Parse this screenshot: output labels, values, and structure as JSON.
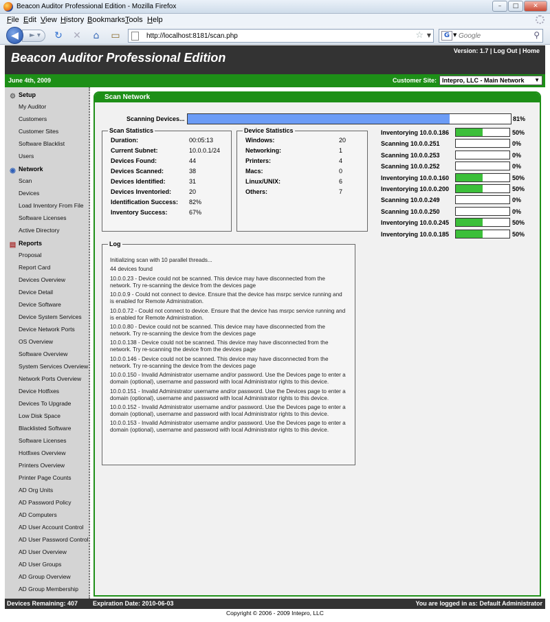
{
  "window": {
    "title": "Beacon Auditor Professional Edition - Mozilla Firefox",
    "controls": [
      "minimize",
      "maximize",
      "close"
    ]
  },
  "menubar": [
    "File",
    "Edit",
    "View",
    "History",
    "Bookmarks",
    "Tools",
    "Help"
  ],
  "navbar": {
    "url": "http://localhost:8181/scan.php",
    "search_placeholder": "Google",
    "search_engine_icon": "G"
  },
  "header": {
    "title": "Beacon Auditor Professional Edition",
    "version": "Version: 1.7",
    "logout": "Log Out",
    "home": "Home",
    "separator": "|"
  },
  "greenbar": {
    "date": "June 4th, 2009",
    "site_label": "Customer Site:",
    "site_value": "Intepro, LLC - Main Network"
  },
  "sidebar": {
    "setup": {
      "label": "Setup",
      "items": [
        "My Auditor",
        "Customers",
        "Customer Sites",
        "Software Blacklist",
        "Users"
      ]
    },
    "network": {
      "label": "Network",
      "items": [
        "Scan",
        "Devices",
        "Load Inventory From File",
        "Software Licenses",
        "Active Directory"
      ]
    },
    "reports": {
      "label": "Reports",
      "items": [
        "Proposal",
        "Report Card",
        "Devices Overview",
        "Device Detail",
        "Device Software",
        "Device System Services",
        "Device Network Ports",
        "OS Overview",
        "Software Overview",
        "System Services Overview",
        "Network Ports Overview",
        "Device Hotfixes",
        "Devices To Upgrade",
        "Low Disk Space",
        "Blacklisted Software",
        "Software Licenses",
        "Hotfixes Overview",
        "Printers Overview",
        "Printer Page Counts",
        "AD Org Units",
        "AD Password Policy",
        "AD Computers",
        "AD User Account Control",
        "AD User Password Control",
        "AD User Overview",
        "AD User Groups",
        "AD Group Overview",
        "AD Group Membership"
      ]
    }
  },
  "content": {
    "title": "Scan Network",
    "scanning_label": "Scanning Devices...",
    "scanning_progress": 0.81,
    "scanning_pct": "81%",
    "scan_stats": {
      "legend": "Scan Statistics",
      "rows": [
        {
          "label": "Duration:",
          "value": "00:05:13"
        },
        {
          "label": "Current Subnet:",
          "value": "10.0.0.1/24"
        },
        {
          "label": "Devices Found:",
          "value": "44"
        },
        {
          "label": "Devices Scanned:",
          "value": "38"
        },
        {
          "label": "Devices Identified:",
          "value": "31"
        },
        {
          "label": "Devices Inventoried:",
          "value": "20"
        },
        {
          "label": "Identification Success:",
          "value": "82%"
        },
        {
          "label": "Inventory Success:",
          "value": "67%"
        }
      ]
    },
    "device_stats": {
      "legend": "Device Statistics",
      "rows": [
        {
          "label": "Windows:",
          "value": "20"
        },
        {
          "label": "Networking:",
          "value": "1"
        },
        {
          "label": "Printers:",
          "value": "4"
        },
        {
          "label": "Macs:",
          "value": "0"
        },
        {
          "label": "Linux/UNIX:",
          "value": "6"
        },
        {
          "label": "Others:",
          "value": "7"
        }
      ]
    },
    "devices": [
      {
        "label": "Inventorying 10.0.0.186",
        "progress": 0.5,
        "pct": "50%"
      },
      {
        "label": "Scanning 10.0.0.251",
        "progress": 0,
        "pct": "0%"
      },
      {
        "label": "Scanning 10.0.0.253",
        "progress": 0,
        "pct": "0%"
      },
      {
        "label": "Scanning 10.0.0.252",
        "progress": 0,
        "pct": "0%"
      },
      {
        "label": "Inventorying 10.0.0.160",
        "progress": 0.5,
        "pct": "50%"
      },
      {
        "label": "Inventorying 10.0.0.200",
        "progress": 0.5,
        "pct": "50%"
      },
      {
        "label": "Scanning 10.0.0.249",
        "progress": 0,
        "pct": "0%"
      },
      {
        "label": "Scanning 10.0.0.250",
        "progress": 0,
        "pct": "0%"
      },
      {
        "label": "Inventorying 10.0.0.245",
        "progress": 0.5,
        "pct": "50%"
      },
      {
        "label": "Inventorying 10.0.0.185",
        "progress": 0.5,
        "pct": "50%"
      }
    ],
    "log": {
      "legend": "Log",
      "lines": [
        "Initializing scan with 10 parallel threads...",
        "44 devices found",
        "10.0.0.23 - Device could not be scanned. This device may have disconnected from the network. Try re-scanning the device from the devices page",
        "10.0.0.9 - Could not connect to device. Ensure that the device has msrpc service running and is enabled for Remote Administration.",
        "10.0.0.72 - Could not connect to device. Ensure that the device has msrpc service running and is enabled for Remote Administration.",
        "10.0.0.80 - Device could not be scanned. This device may have disconnected from the network. Try re-scanning the device from the devices page",
        "10.0.0.138 - Device could not be scanned. This device may have disconnected from the network. Try re-scanning the device from the devices page",
        "10.0.0.146 - Device could not be scanned. This device may have disconnected from the network. Try re-scanning the device from the devices page",
        "10.0.0.150 - Invalid Administrator username and/or password. Use the Devices page to enter a domain (optional), username and password with local Administrator rights to this device.",
        "10.0.0.151 - Invalid Administrator username and/or password. Use the Devices page to enter a domain (optional), username and password with local Administrator rights to this device.",
        "10.0.0.152 - Invalid Administrator username and/or password. Use the Devices page to enter a domain (optional), username and password with local Administrator rights to this device.",
        "10.0.0.153 - Invalid Administrator username and/or password. Use the Devices page to enter a domain (optional), username and password with local Administrator rights to this device."
      ]
    }
  },
  "footer": {
    "remaining": "Devices Remaining: 407",
    "expiration": "Expiration Date: 2010-06-03",
    "logged_in": "You are logged in as: Default Administrator",
    "copyright": "Copyright © 2006 - 2009 Intepro, LLC"
  },
  "colors": {
    "header_bg": "#333333",
    "green": "#1d8f17",
    "progress_blue": "#6c9cf6",
    "progress_green": "#3cbf3a",
    "sidebar_bg": "#d4d4d4"
  }
}
